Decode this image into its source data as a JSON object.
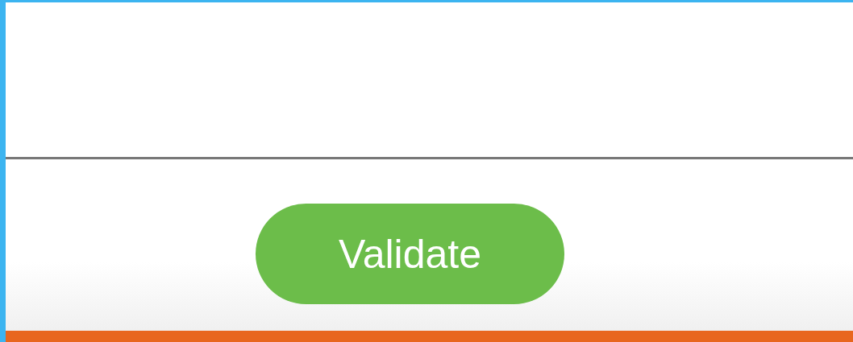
{
  "button": {
    "label": "Validate"
  }
}
